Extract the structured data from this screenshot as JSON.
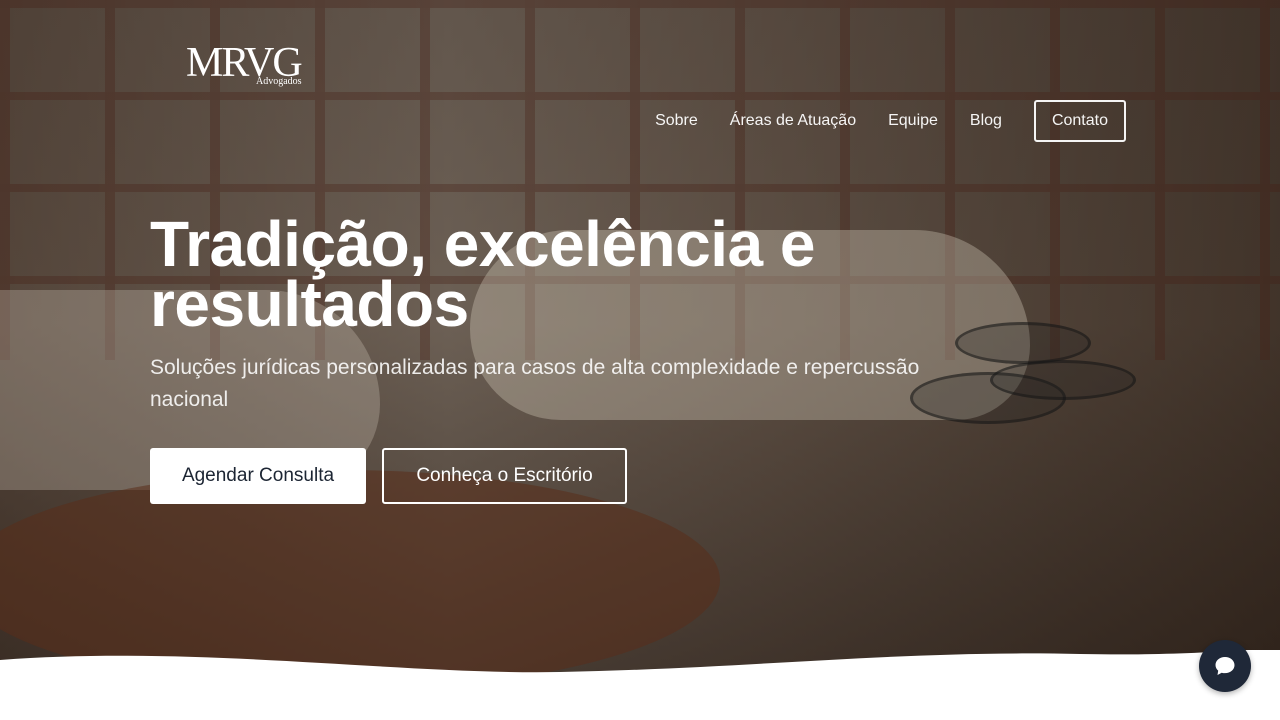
{
  "brand": {
    "logo_mark": "MRVG",
    "logo_sub": "Advogados"
  },
  "nav": {
    "items": [
      {
        "label": "Sobre"
      },
      {
        "label": "Áreas de Atuação"
      },
      {
        "label": "Equipe"
      },
      {
        "label": "Blog"
      }
    ],
    "contact_label": "Contato"
  },
  "hero": {
    "title": "Tradição, excelência e resultados",
    "subtitle": "Soluções jurídicas personalizadas para casos de alta complexidade e repercussão nacional",
    "primary_button": "Agendar Consulta",
    "secondary_button": "Conheça o Escritório"
  },
  "chat": {
    "icon": "chat-bubble-icon"
  },
  "colors": {
    "button_dark": "#1f2838",
    "text_on_primary": "#1c2533"
  }
}
